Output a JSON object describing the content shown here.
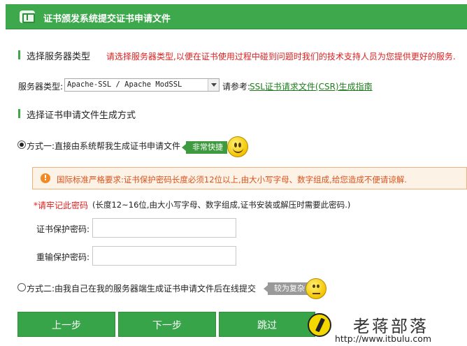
{
  "header": {
    "title": "证书颁发系统提交证书申请文件",
    "icon": "certificate-icon"
  },
  "section_server": {
    "title": "选择服务器类型",
    "hint": "请选择服务器类型,以便在证书使用过程中碰到问题时我们的技术支持人员为您提供更好的服务."
  },
  "server": {
    "label": "服务器类型:",
    "selected": "Apache-SSL / Apache ModSSL",
    "ref_label": "请参考:",
    "ref_link": "SSL证书请求文件(CSR)生成指南"
  },
  "section_method": {
    "title": "选择证书申请文件生成方式"
  },
  "method1": {
    "label": "方式一:直接由系统帮我生成证书申请文件",
    "tag": "非常快捷",
    "checked": true
  },
  "warning": {
    "text": "国际标准严格要求:证书保护密码长度必须12位以上,由大小写字母、数字组成,给您造成不便请谅解."
  },
  "password_hint": {
    "required": "*请牢记此密码",
    "detail": "(长度12~16位,由大小写字母、数字组成,证书安装或解压时需要此密码.)"
  },
  "fields": {
    "password_label": "证书保护密码:",
    "confirm_label": "重输保护密码:"
  },
  "method2": {
    "label": "方式二:由我自己在我的服务器端生成证书申请文件后在线提交",
    "tag": "较为复杂",
    "checked": false
  },
  "buttons": {
    "prev": "上一步",
    "next": "下一步",
    "skip": "跳过"
  },
  "watermark": {
    "name": "老蒋部落",
    "url": "http://www.itbulu.com"
  },
  "colors": {
    "accent": "#3ea84d",
    "warning": "#d9531e",
    "hint": "#e02020",
    "link": "#1e7e1e"
  }
}
